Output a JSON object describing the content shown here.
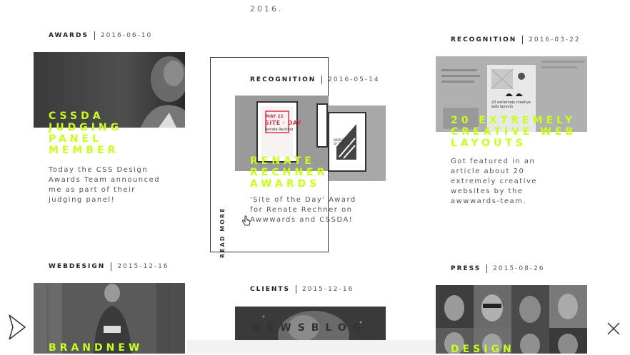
{
  "top_text": "2016.",
  "cards": [
    {
      "category": "AWARDS",
      "date": "2016-06-10",
      "headline": "CSSDA\nJUDGING\nPANEL\nMEMBER",
      "description": "Today the CSS Design\nAwards Team announced\nme as part of their\njudging panel!"
    },
    {
      "category": "RECOGNITION",
      "date": "2016-05-14",
      "headline": "RENATE\nRECHNER\nAWARDS",
      "description": "'Site of the Day' Award\nfor Renate Rechner on\nAwwwards and CSSDA!",
      "read_more": "READ MORE",
      "poster_texts": {
        "date": "MAY 22",
        "title": "SITE · DAY",
        "subtitle": "Renate Rechner",
        "right_title": "WEBSITE OF THE DAY"
      }
    },
    {
      "category": "RECOGNITION",
      "date": "2016-03-22",
      "headline": "20 EXTREMELY\nCREATIVE WEB\nLAYOUTS",
      "description": "Got featured in an\narticle about 20\nextremely creative\nwebsites by the\nawwwards-team.",
      "article_text": "20 extremely creative web layouts"
    },
    {
      "category": "WEBDESIGN",
      "date": "2015-12-16",
      "headline": "BRANDNEW"
    },
    {
      "category": "CLIENTS",
      "date": "2015-12-16",
      "headline": "NEWSBLOG"
    },
    {
      "category": "PRESS",
      "date": "2015-08-26",
      "headline": "DESIGN"
    }
  ],
  "nav": {
    "play_icon": "play-outline-icon",
    "close_icon": "close-x-icon"
  },
  "colors": {
    "accent": "#c8ff1a",
    "text": "#444444",
    "background": "#ffffff"
  }
}
